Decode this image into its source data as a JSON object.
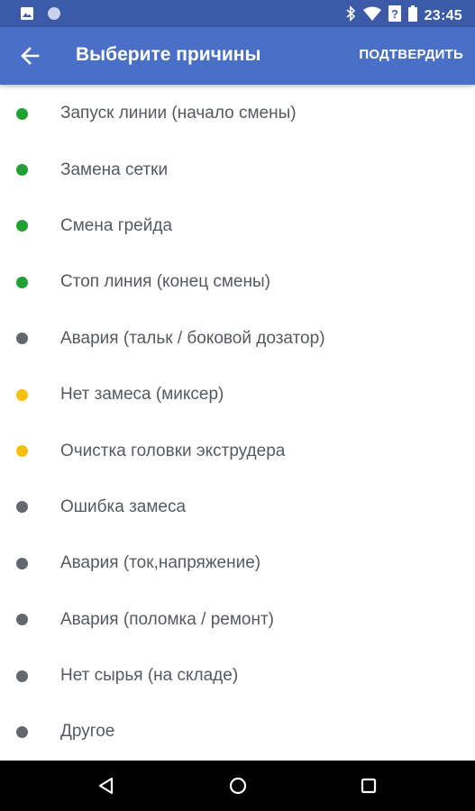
{
  "status_bar": {
    "time": "23:45",
    "icons": [
      "image-icon",
      "circle-icon",
      "bluetooth-icon",
      "wifi-icon",
      "battery-icon"
    ]
  },
  "app_bar": {
    "title": "Выберите причины",
    "confirm_label": "ПОДТВЕРДИТЬ",
    "back_icon": "arrow-back-icon"
  },
  "colors": {
    "app_bar": "#4a6fc7",
    "status_bar": "#3b5aa8",
    "green": "#22a033",
    "gray": "#62686e",
    "yellow": "#f8c00e"
  },
  "reasons": [
    {
      "label": "Запуск линии (начало смены)",
      "status": "green"
    },
    {
      "label": "Замена сетки",
      "status": "green"
    },
    {
      "label": "Смена грейда",
      "status": "green"
    },
    {
      "label": "Стоп линия (конец смены)",
      "status": "green"
    },
    {
      "label": "Авария (тальк / боковой дозатор)",
      "status": "gray"
    },
    {
      "label": "Нет замеса (миксер)",
      "status": "yellow"
    },
    {
      "label": "Очистка головки экструдера",
      "status": "yellow"
    },
    {
      "label": "Ошибка замеса",
      "status": "gray"
    },
    {
      "label": "Авария (ток,напряжение)",
      "status": "gray"
    },
    {
      "label": "Авария (поломка / ремонт)",
      "status": "gray"
    },
    {
      "label": "Нет сырья (на складе)",
      "status": "gray"
    },
    {
      "label": "Другое",
      "status": "gray"
    }
  ],
  "nav_bar": {
    "icons": [
      "back-triangle-icon",
      "home-circle-icon",
      "recents-square-icon"
    ]
  }
}
